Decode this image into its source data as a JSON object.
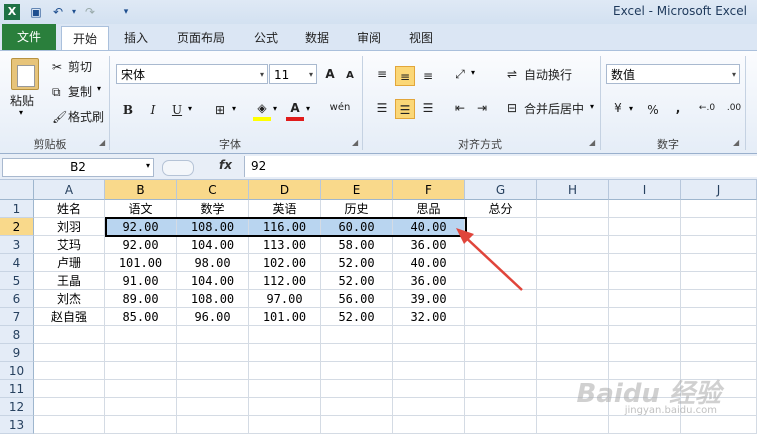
{
  "window": {
    "title": "Excel  -  Microsoft Excel"
  },
  "tabs": [
    "文件",
    "开始",
    "插入",
    "页面布局",
    "公式",
    "数据",
    "审阅",
    "视图"
  ],
  "ribbon": {
    "clipboard": {
      "paste": "粘贴",
      "cut": "剪切",
      "copy": "复制",
      "format_painter": "格式刷",
      "label": "剪贴板"
    },
    "font": {
      "name": "宋体",
      "size": "11",
      "bold": "B",
      "italic": "I",
      "underline": "U",
      "grow": "A",
      "shrink": "A",
      "pinyin": "wén",
      "label": "字体"
    },
    "alignment": {
      "wrap": "自动换行",
      "merge": "合并后居中",
      "label": "对齐方式"
    },
    "number": {
      "format": "数值",
      "percent": "%",
      "comma": ",",
      "label": "数字"
    }
  },
  "formula_bar": {
    "name_box": "B2",
    "fx": "fx",
    "value": "92"
  },
  "columns": [
    "A",
    "B",
    "C",
    "D",
    "E",
    "F",
    "G",
    "H",
    "I",
    "J"
  ],
  "rows": [
    "1",
    "2",
    "3",
    "4",
    "5",
    "6",
    "7",
    "8",
    "9",
    "10",
    "11",
    "12",
    "13"
  ],
  "cells": {
    "header": [
      "姓名",
      "语文",
      "数学",
      "英语",
      "历史",
      "思品",
      "总分"
    ],
    "data": [
      [
        "刘羽",
        "92.00",
        "108.00",
        "116.00",
        "60.00",
        "40.00"
      ],
      [
        "艾玛",
        "92.00",
        "104.00",
        "113.00",
        "58.00",
        "36.00"
      ],
      [
        "卢珊",
        "101.00",
        "98.00",
        "102.00",
        "52.00",
        "40.00"
      ],
      [
        "王晶",
        "91.00",
        "104.00",
        "112.00",
        "52.00",
        "36.00"
      ],
      [
        "刘杰",
        "89.00",
        "108.00",
        "97.00",
        "56.00",
        "39.00"
      ],
      [
        "赵自强",
        "85.00",
        "96.00",
        "101.00",
        "52.00",
        "32.00"
      ]
    ]
  },
  "watermark": {
    "brand": "Baidu 经验",
    "url": "jingyan.baidu.com"
  },
  "colors": {
    "selection": "#b9d5f0",
    "header_selected": "#f9d98b",
    "file_tab": "#2a7f3c",
    "arrow": "#e0453b"
  }
}
